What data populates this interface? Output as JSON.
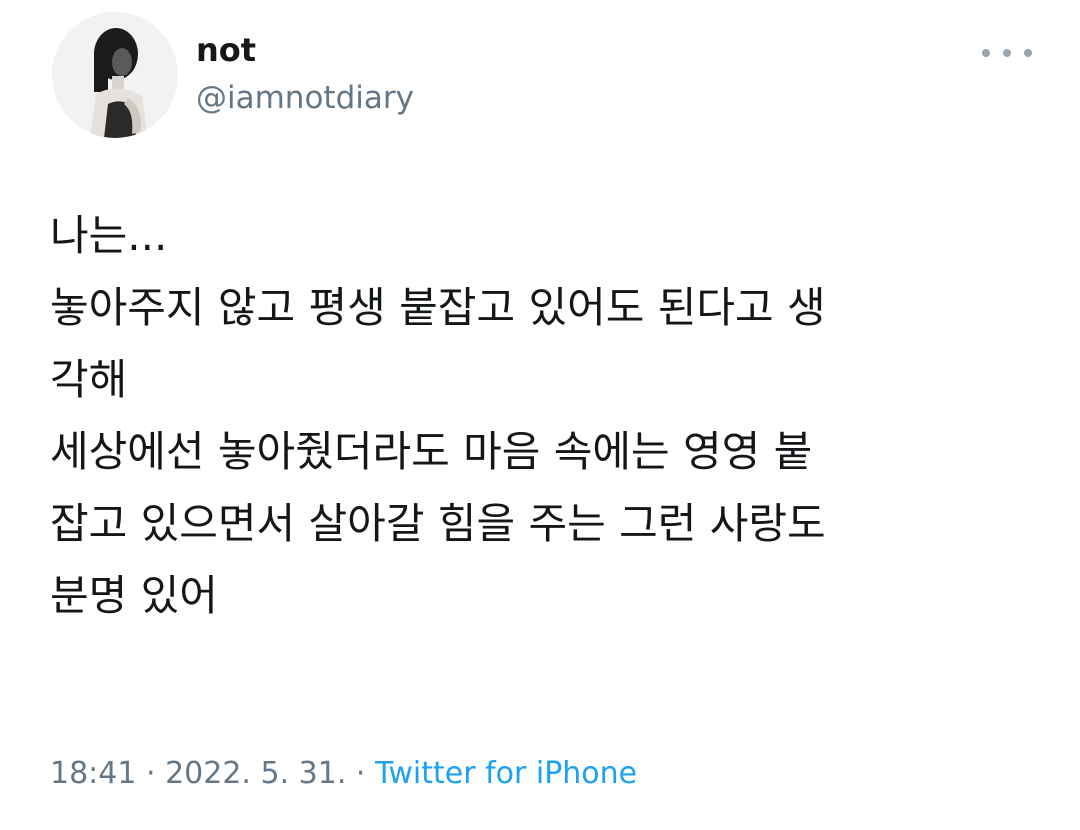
{
  "user": {
    "display_name": "not",
    "handle": "@iamnotdiary",
    "avatar_icon": "profile-photo"
  },
  "more_icon": "more-horizontal-icon",
  "tweet": {
    "lines": [
      "나는...",
      "놓아주지 않고 평생 붙잡고 있어도 된다고 생",
      "각해",
      "세상에선 놓아줬더라도 마음 속에는 영영 붙",
      "잡고 있으면서 살아갈 힘을 주는 그런 사랑도",
      "분명 있어"
    ]
  },
  "meta": {
    "time": "18:41",
    "separator": " · ",
    "date": "2022. 5. 31.",
    "separator2": " · ",
    "source": "Twitter for iPhone"
  },
  "colors": {
    "text": "#14171a",
    "secondary": "#657786",
    "link": "#1da1f2"
  }
}
